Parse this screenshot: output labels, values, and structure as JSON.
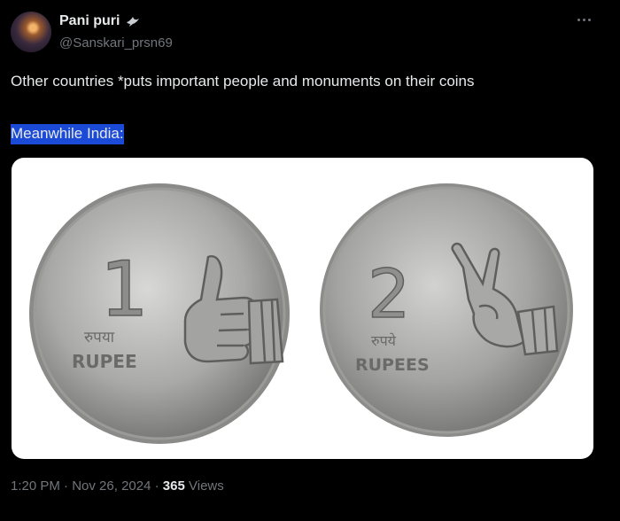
{
  "author": {
    "name": "Pani puri",
    "handle": "@Sanskari_prsn69"
  },
  "icons": {
    "badge": "dove-icon",
    "more": "more-horizontal-icon"
  },
  "tweet": {
    "line1": "Other countries *puts important people and monuments on their coins",
    "line2": "Meanwhile India:"
  },
  "media": {
    "coin_left": {
      "numeral": "1",
      "hindi": "रुपया",
      "english": "RUPEE",
      "gesture": "thumbs-up"
    },
    "coin_right": {
      "numeral": "2",
      "hindi": "रुपये",
      "english": "RUPEES",
      "gesture": "victory-hand"
    }
  },
  "meta": {
    "time": "1:20 PM",
    "sep": "·",
    "date": "Nov 26, 2024",
    "views_count": "365",
    "views_label": "Views"
  },
  "colors": {
    "background": "#000000",
    "text": "#e7e9ea",
    "muted": "#71767b",
    "highlight": "#1a4ad6"
  }
}
